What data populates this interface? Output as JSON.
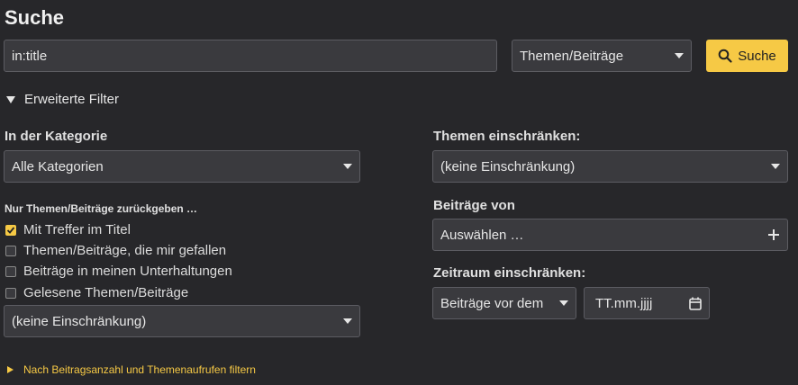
{
  "page": {
    "title": "Suche"
  },
  "search": {
    "value": "in:title",
    "type_select": "Themen/Beiträge",
    "button_label": "Suche"
  },
  "advanced": {
    "toggle_label": "Erweiterte Filter"
  },
  "left": {
    "category_label": "In der Kategorie",
    "category_select": "Alle Kategorien",
    "only_label": "Nur Themen/Beiträge zurückgeben …",
    "checks": [
      {
        "label": "Mit Treffer im Titel",
        "checked": true
      },
      {
        "label": "Themen/Beiträge, die mir gefallen",
        "checked": false
      },
      {
        "label": "Beiträge in meinen Unterhaltungen",
        "checked": false
      },
      {
        "label": "Gelesene Themen/Beiträge",
        "checked": false
      }
    ],
    "status_select": "(keine Einschränkung)"
  },
  "right": {
    "restrict_label": "Themen einschränken:",
    "restrict_select": "(keine Einschränkung)",
    "posts_by_label": "Beiträge von",
    "posts_by_placeholder": "Auswählen …",
    "timeframe_label": "Zeitraum einschränken:",
    "timeframe_select": "Beiträge vor dem",
    "date_placeholder": "TT.mm.jjjj"
  },
  "footer": {
    "link_label": "Nach Beitragsanzahl und Themenaufrufen filtern"
  },
  "colors": {
    "accent": "#f6c945",
    "background": "#27272a",
    "field": "#3a3a3e"
  }
}
